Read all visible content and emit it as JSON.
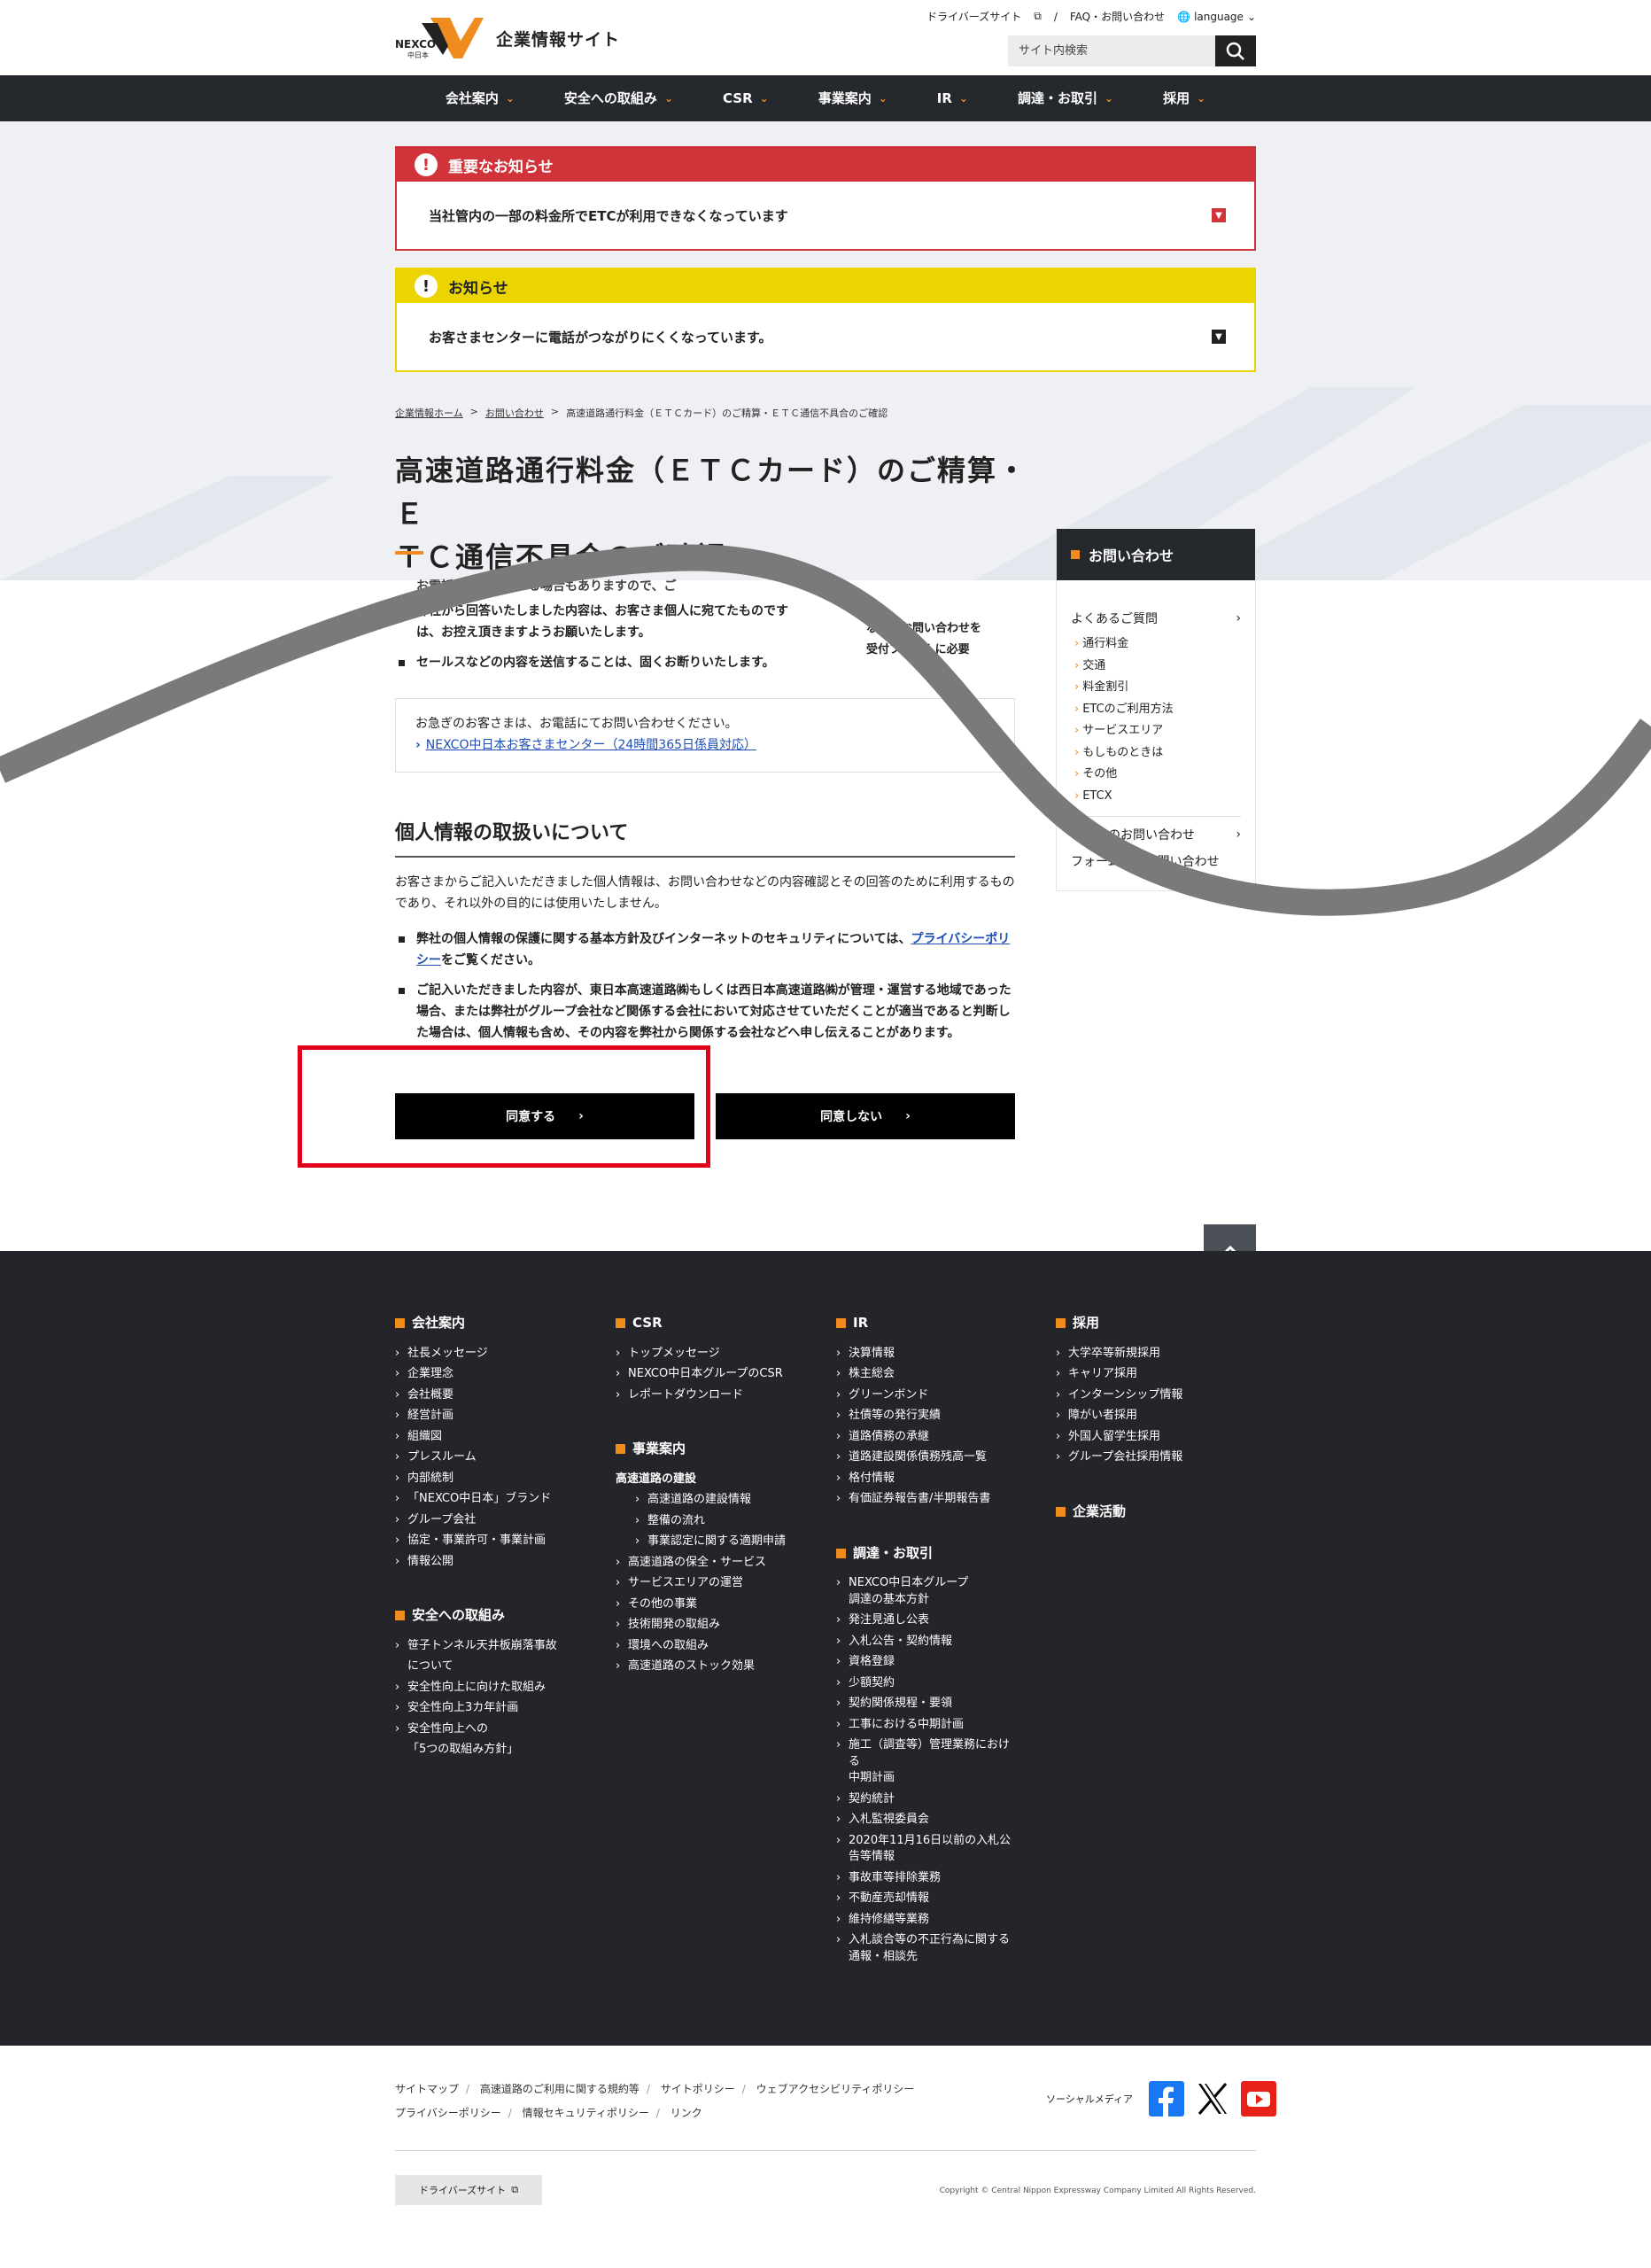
{
  "header": {
    "logo_text": "NEXCO",
    "logo_sub": "中日本",
    "site_name": "企業情報サイト",
    "driver_site": "ドライバーズサイト",
    "faq": "FAQ・お問い合わせ",
    "language": "language",
    "search_placeholder": "サイト内検索"
  },
  "gnav": [
    "会社案内",
    "安全への取組み",
    "CSR",
    "事業案内",
    "IR",
    "調達・お取引",
    "採用"
  ],
  "notice_important": {
    "title": "重要なお知らせ",
    "text": "当社管内の一部の料金所でETCが利用できなくなっています"
  },
  "notice_general": {
    "title": "お知らせ",
    "text": "お客さまセンターに電話がつながりにくくなっています。"
  },
  "breadcrumb": [
    "企業情報ホーム",
    "お問い合わせ",
    "高速道路通行料金（ＥＴＣカード）のご精算・ＥＴＣ通信不具合のご確認"
  ],
  "page_title_1": "高速道路通行料金（ＥＴＣカード）のご精算・Ｅ",
  "page_title_2": "ＴＣ通信不具合のご確認",
  "body": {
    "line0": "お電話にてご連絡する場合もありますので、ご",
    "li1a": "弊社から回答いたしました内容は、お客さま個人に宛てたものです",
    "li1b": "は、お控え頂きますようお願いたします。",
    "li2": "セールスなどの内容を送信することは、固くお断りいたします。",
    "side_frag1": "などのお問い合わせを",
    "side_frag2": "受付フォームに必要"
  },
  "contact": {
    "text": "お急ぎのお客さまは、お電話にてお問い合わせください。",
    "link": "NEXCO中日本お客さまセンター（24時間365日係員対応）"
  },
  "privacy": {
    "title": "個人情報の取扱いについて",
    "intro": "お客さまからご記入いただきました個人情報は、お問い合わせなどの内容確認とその回答のために利用するものであり、それ以外の目的には使用いたしません。",
    "li1_pre": "弊社の個人情報の保護に関する基本方針及びインターネットのセキュリティについては、",
    "li1_link": "プライバシーポリシー",
    "li1_post": "をご覧ください。",
    "li2": "ご記入いただきました内容が、東日本高速道路㈱もしくは西日本高速道路㈱が管理・運営する地域であった場合、または弊社がグループ会社など関係する会社において対応させていただくことが適当であると判断した場合は、個人情報も含め、その内容を弊社から関係する会社などへ申し伝えることがあります。"
  },
  "buttons": {
    "agree": "同意する",
    "disagree": "同意しない"
  },
  "sidebar": {
    "title": "お問い合わせ",
    "faq": "よくあるご質問",
    "items": [
      "通行料金",
      "交通",
      "料金割引",
      "ETCのご利用方法",
      "サービスエリア",
      "もしものときは",
      "その他",
      "ETCX"
    ],
    "phone": "電話でのお問い合わせ",
    "form": "フォームでのお問い合わせ"
  },
  "footer": {
    "col1": {
      "h": "会社案内",
      "items": [
        "社長メッセージ",
        "企業理念",
        "会社概要",
        "経営計画",
        "組織図",
        "プレスルーム",
        "内部統制",
        "「NEXCO中日本」ブランド",
        "グループ会社",
        "協定・事業許可・事業計画",
        "情報公開"
      ],
      "h2": "安全への取組み",
      "items2": [
        "笹子トンネル天井板崩落事故",
        "について",
        "安全性向上に向けた取組み",
        "安全性向上3カ年計画",
        "安全性向上への",
        "「5つの取組み方針」"
      ]
    },
    "col2": {
      "h": "CSR",
      "items": [
        "トップメッセージ",
        "NEXCO中日本グループのCSR",
        "レポートダウンロード"
      ],
      "h2": "事業案内",
      "sub": "高速道路の建設",
      "subitems": [
        "高速道路の建設情報",
        "整備の流れ",
        "事業認定に関する適期申請"
      ],
      "items2": [
        "高速道路の保全・サービス",
        "サービスエリアの運営",
        "その他の事業",
        "技術開発の取組み",
        "環境への取組み",
        "高速道路のストック効果"
      ]
    },
    "col3": {
      "h": "IR",
      "items": [
        "決算情報",
        "株主総会",
        "グリーンボンド",
        "社債等の発行実績",
        "道路債務の承継",
        "道路建設関係債務残高一覧",
        "格付情報",
        "有価証券報告書/半期報告書"
      ],
      "h2": "調達・お取引",
      "items2": [
        "NEXCO中日本グループ",
        "調達の基本方針",
        "発注見通し公表",
        "入札公告・契約情報",
        "資格登録",
        "少額契約",
        "契約関係規程・要領",
        "工事における中期計画",
        "施工（調査等）管理業務におけ",
        "る",
        "中期計画",
        "契約統計",
        "入札監視委員会",
        "2020年11月16日以前の入札公",
        "告等情報",
        "事故車等排除業務",
        "不動産売却情報",
        "維持修繕等業務",
        "入札談合等の不正行為に関する",
        "通報・相談先"
      ]
    },
    "col4": {
      "h": "採用",
      "items": [
        "大学卒等新規採用",
        "キャリア採用",
        "インターンシップ情報",
        "障がい者採用",
        "外国人留学生採用",
        "グループ会社採用情報"
      ],
      "h2": "企業活動"
    }
  },
  "bottom": {
    "links1": [
      "サイトマップ",
      "高速道路のご利用に関する規約等",
      "サイトポリシー",
      "ウェブアクセシビリティポリシー"
    ],
    "links2": [
      "プライバシーポリシー",
      "情報セキュリティポリシー",
      "リンク"
    ],
    "social_label": "ソーシャルメディア",
    "driver_btn": "ドライバーズサイト",
    "copyright": "Copyright © Central Nippon Expressway Company Limited All Rights Reserved."
  }
}
